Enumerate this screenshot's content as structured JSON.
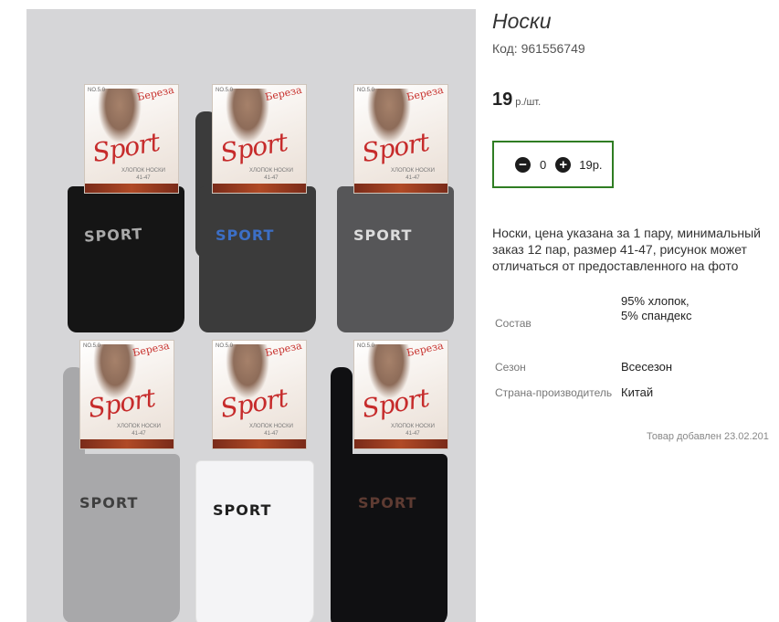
{
  "product": {
    "title": "Носки",
    "code": "Код: 961556749",
    "price_value": "19",
    "price_unit": "р./шт.",
    "image_alt": "Носки Sport"
  },
  "quantity": {
    "value": "0",
    "total": "19р.",
    "minus_icon": "minus-circle-icon",
    "plus_icon": "plus-circle-icon"
  },
  "description": "Носки, цена указана за 1 пару, минимальный заказ 12 пар, размер 41-47, рисунок может отличаться от предоставленного на фото",
  "specs": [
    {
      "label": "Состав",
      "value": "95% хлопок, 5% спандекс"
    },
    {
      "label": "Сезон",
      "value": "Всесезон"
    },
    {
      "label": "Страна-производитель",
      "value": "Китай"
    }
  ],
  "added": "Товар добавлен 23.02.201",
  "packs": [
    {
      "brand": "Береза",
      "logo": "Sport",
      "small": "ХЛОПОК НОСКИ\n41-47",
      "sock_word": "SPORT",
      "sock_color": "#151515",
      "word_color": "#a9a9a9"
    },
    {
      "brand": "Береза",
      "logo": "Sport",
      "small": "ХЛОПОК НОСКИ\n41-47",
      "sock_word": "SPORT",
      "sock_color": "#3b3b3b",
      "word_color": "#3c6fc6"
    },
    {
      "brand": "Береза",
      "logo": "Sport",
      "small": "ХЛОПОК НОСКИ\n41-47",
      "sock_word": "SPORT",
      "sock_color": "#565658",
      "word_color": "#dcdcdc"
    },
    {
      "brand": "Береза",
      "logo": "Sport",
      "small": "ХЛОПОК НОСКИ\n41-47",
      "sock_word": "SPORT",
      "sock_color": "#a8a8aa",
      "word_color": "#3f3f3f"
    },
    {
      "brand": "Береза",
      "logo": "Sport",
      "small": "ХЛОПОК НОСКИ\n41-47",
      "sock_word": "SPORT",
      "sock_color": "#f4f4f6",
      "word_color": "#1f1f1f"
    },
    {
      "brand": "Береза",
      "logo": "Sport",
      "small": "ХЛОПОК НОСКИ\n41-47",
      "sock_word": "SPORT",
      "sock_color": "#101012",
      "word_color": "#5e3b32"
    }
  ]
}
